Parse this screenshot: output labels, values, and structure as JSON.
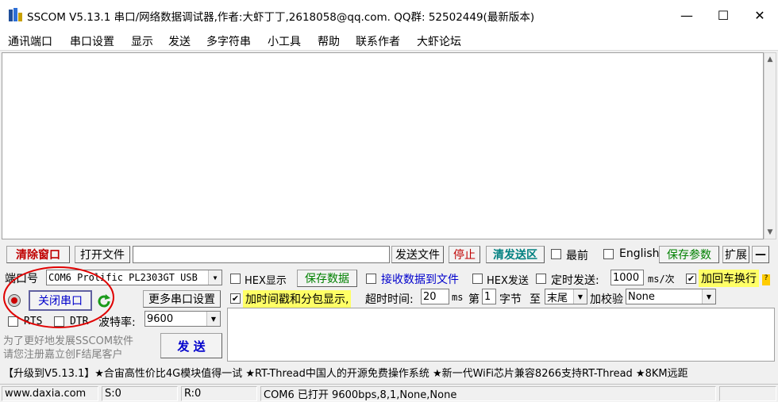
{
  "window": {
    "title": "SSCOM V5.13.1 串口/网络数据调试器,作者:大虾丁丁,2618058@qq.com. QQ群:  52502449(最新版本)",
    "minimize": "—",
    "maximize": "☐",
    "close": "✕"
  },
  "menu": [
    "通讯端口",
    "串口设置",
    "显示",
    "发送",
    "多字符串",
    "小工具",
    "帮助",
    "联系作者",
    "大虾论坛"
  ],
  "toolbar": {
    "clear": "清除窗口",
    "open_file": "打开文件",
    "send_file": "发送文件",
    "stop": "停止",
    "clear_send": "清发送区",
    "last": "最前",
    "english": "English",
    "save_params": "保存参数",
    "expand": "扩展",
    "collapse": "—"
  },
  "port": {
    "label": "端口号",
    "value": "COM6 Prolific PL2303GT USB",
    "close_btn": "关闭串口",
    "more_settings": "更多串口设置",
    "rts": "RTS",
    "dtr": "DTR",
    "baud_label": "波特率:",
    "baud": "9600"
  },
  "promo": {
    "line1": "为了更好地发展SSCOM软件",
    "line2": "请您注册嘉立创F结尾客户",
    "send": "发 送"
  },
  "options": {
    "hex_show": "HEX显示",
    "save_data": "保存数据",
    "recv_to_file": "接收数据到文件",
    "hex_send": "HEX发送",
    "timed_send": "定时发送:",
    "interval": "1000",
    "interval_unit": "ms/次",
    "add_crlf": "加回车换行",
    "add_ts": "加时间戳和分包显示,",
    "timeout_label": "超时时间:",
    "timeout": "20",
    "ms": "ms",
    "di": "第",
    "byte_index": "1",
    "byte": "字节",
    "to": "至",
    "end": "末尾",
    "checksum": "加校验",
    "checksum_val": "None"
  },
  "ticker": "【升级到V5.13.1】★合宙高性价比4G模块值得一试 ★RT-Thread中国人的开源免费操作系统 ★新一代WiFi芯片兼容8266支持RT-Thread ★8KM远距",
  "status": {
    "site": "www.daxia.com",
    "sent": "S:0",
    "recv": "R:0",
    "port_state": "COM6 已打开  9600bps,8,1,None,None"
  }
}
